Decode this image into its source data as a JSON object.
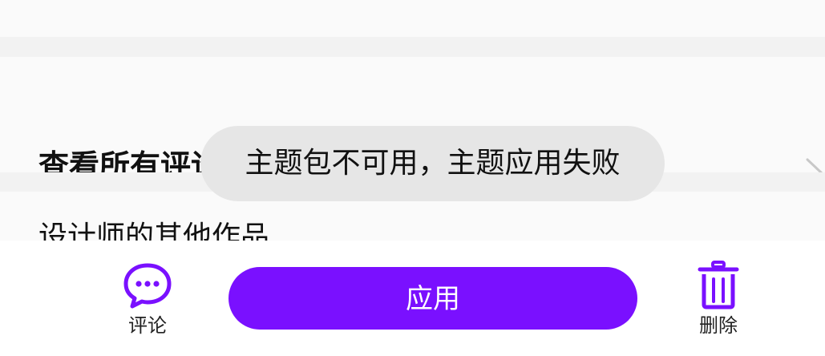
{
  "sections": {
    "comments_title": "查看所有评论",
    "other_works_title": "设计师的其他作品"
  },
  "bottom_bar": {
    "comment_label": "评论",
    "apply_label": "应用",
    "delete_label": "删除",
    "comment_icon": "speech-bubble-icon",
    "delete_icon": "trash-icon"
  },
  "toast": {
    "message": "主题包不可用，主题应用失败"
  },
  "colors": {
    "accent": "#7a10ff",
    "toast_background": "#e6e6e6",
    "divider": "#f2f2f2"
  }
}
